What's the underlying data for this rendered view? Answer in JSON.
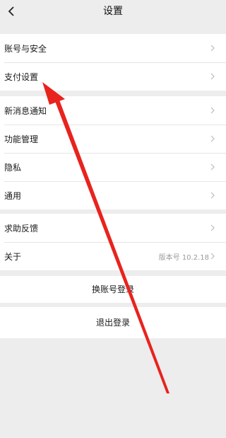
{
  "header": {
    "title": "设置"
  },
  "group1": [
    {
      "label": "账号与安全"
    },
    {
      "label": "支付设置"
    }
  ],
  "group2": [
    {
      "label": "新消息通知"
    },
    {
      "label": "功能管理"
    },
    {
      "label": "隐私"
    },
    {
      "label": "通用"
    }
  ],
  "group3": [
    {
      "label": "求助反馈"
    },
    {
      "label": "关于",
      "value": "版本号 10.2.18"
    }
  ],
  "actions": {
    "switch_account": "换账号登录",
    "logout": "退出登录"
  },
  "annotation": {
    "arrow_color": "#e8231e"
  }
}
